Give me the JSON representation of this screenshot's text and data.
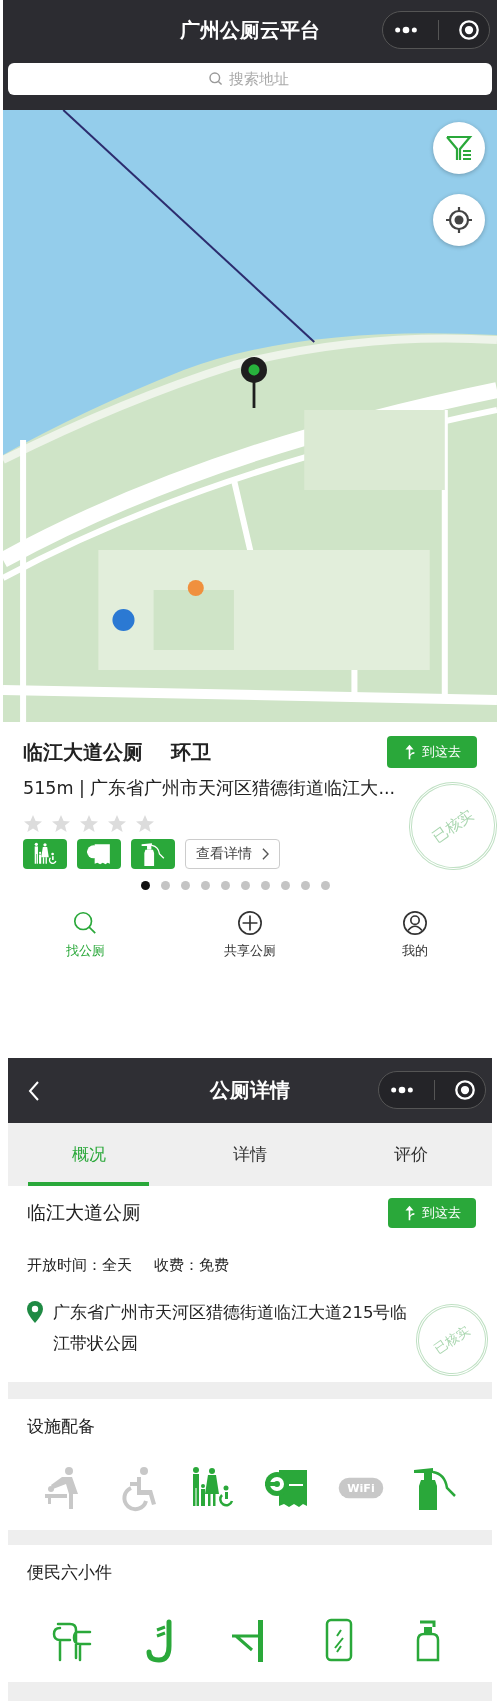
{
  "map_screen": {
    "title": "广州公厕云平台",
    "search": {
      "placeholder": "搜索地址"
    },
    "card": {
      "name": "临江大道公厕",
      "category": "环卫",
      "go_button": "到这去",
      "address": "515m | 广东省广州市天河区猎德街道临江大...",
      "stars": 0,
      "features": [
        {
          "kind": "family"
        },
        {
          "kind": "toilet-paper"
        },
        {
          "kind": "sprayer"
        }
      ],
      "details_button": "查看详情",
      "stamp": "已核实",
      "pager": [
        {
          "selected": true
        },
        {
          "selected": false
        },
        {
          "selected": false
        },
        {
          "selected": false
        },
        {
          "selected": false
        },
        {
          "selected": false
        },
        {
          "selected": false
        },
        {
          "selected": false
        },
        {
          "selected": false
        },
        {
          "selected": false
        }
      ]
    },
    "nav": [
      {
        "kind": "search",
        "label": "找公厕",
        "selected": true
      },
      {
        "kind": "add",
        "label": "共享公厕",
        "selected": false
      },
      {
        "kind": "user",
        "label": "我的",
        "selected": false
      }
    ]
  },
  "detail_screen": {
    "title": "公厕详情",
    "tabs": [
      {
        "label": "概况",
        "selected": true
      },
      {
        "label": "详情",
        "selected": false
      },
      {
        "label": "评价",
        "selected": false
      }
    ],
    "name": "临江大道公厕",
    "go_button": "到这去",
    "hours": "开放时间：全天",
    "fee": "收费：免费",
    "address": "广东省广州市天河区猎德街道临江大道215号临江带状公园",
    "stamp": "已核实",
    "facilities": {
      "title": "设施配备",
      "items": [
        {
          "kind": "baby-changing",
          "available": false
        },
        {
          "kind": "wheelchair",
          "available": false
        },
        {
          "kind": "family",
          "available": true
        },
        {
          "kind": "toilet-paper",
          "available": true
        },
        {
          "kind": "wifi",
          "available": false,
          "label": "WiFi"
        },
        {
          "kind": "sprayer",
          "available": true
        }
      ]
    },
    "conveniences": {
      "title": "便民六小件",
      "items": [
        {
          "kind": "handrail"
        },
        {
          "kind": "hook"
        },
        {
          "kind": "shelf"
        },
        {
          "kind": "mirror"
        },
        {
          "kind": "soap"
        }
      ]
    }
  }
}
